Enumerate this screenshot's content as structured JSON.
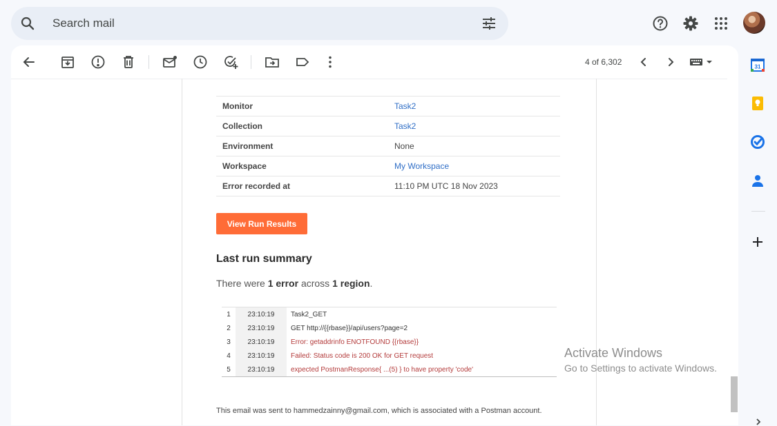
{
  "search": {
    "placeholder": "Search mail"
  },
  "top_icons": [
    "help-icon",
    "settings-gear-icon",
    "apps-grid-icon",
    "account-avatar"
  ],
  "toolbar": {
    "icons": [
      "back-arrow-icon",
      "archive-icon",
      "report-spam-icon",
      "delete-icon",
      "mark-unread-icon",
      "snooze-icon",
      "add-to-tasks-icon",
      "move-to-icon",
      "label-icon",
      "more-vert-icon"
    ],
    "count": "4 of 6,302"
  },
  "email": {
    "info_rows": [
      {
        "key": "Monitor",
        "value": "Task2",
        "link": true
      },
      {
        "key": "Collection",
        "value": "Task2",
        "link": true
      },
      {
        "key": "Environment",
        "value": "None",
        "link": false
      },
      {
        "key": "Workspace",
        "value": "My Workspace",
        "link": true
      },
      {
        "key": "Error recorded at",
        "value": "11:10 PM UTC 18 Nov 2023",
        "link": false
      }
    ],
    "button_label": "View Run Results",
    "summary_title": "Last run summary",
    "summary_text": {
      "prefix": "There were ",
      "errors": "1 error",
      "middle": " across ",
      "regions": "1 region",
      "suffix": "."
    },
    "log_rows": [
      {
        "n": "1",
        "time": "23:10:19",
        "msg": "Task2_GET",
        "error": false
      },
      {
        "n": "2",
        "time": "23:10:19",
        "msg": "GET http://{{rbase}}/api/users?page=2",
        "error": false
      },
      {
        "n": "3",
        "time": "23:10:19",
        "msg": "Error: getaddrinfo ENOTFOUND {{rbase}}",
        "error": true
      },
      {
        "n": "4",
        "time": "23:10:19",
        "msg": "Failed: Status code is 200 OK for GET request",
        "error": true
      },
      {
        "n": "5",
        "time": "23:10:19",
        "msg": "expected PostmanResponse{ ...(5) } to have property 'code'",
        "error": true
      }
    ],
    "footer": "This email was sent to hammedzainny@gmail.com, which is associated with a Postman account."
  },
  "watermark": {
    "line1": "Activate Windows",
    "line2": "Go to Settings to activate Windows."
  },
  "side_panel": {
    "icons": [
      "calendar-icon",
      "keep-icon",
      "tasks-icon",
      "contacts-icon",
      "add-icon"
    ],
    "calendar_day": "31"
  },
  "colors": {
    "accent_button": "#ff6c37",
    "link": "#2f6ec6",
    "error_text": "#b33a3a",
    "search_bg": "#e9eef6",
    "page_bg": "#f6f8fc"
  }
}
